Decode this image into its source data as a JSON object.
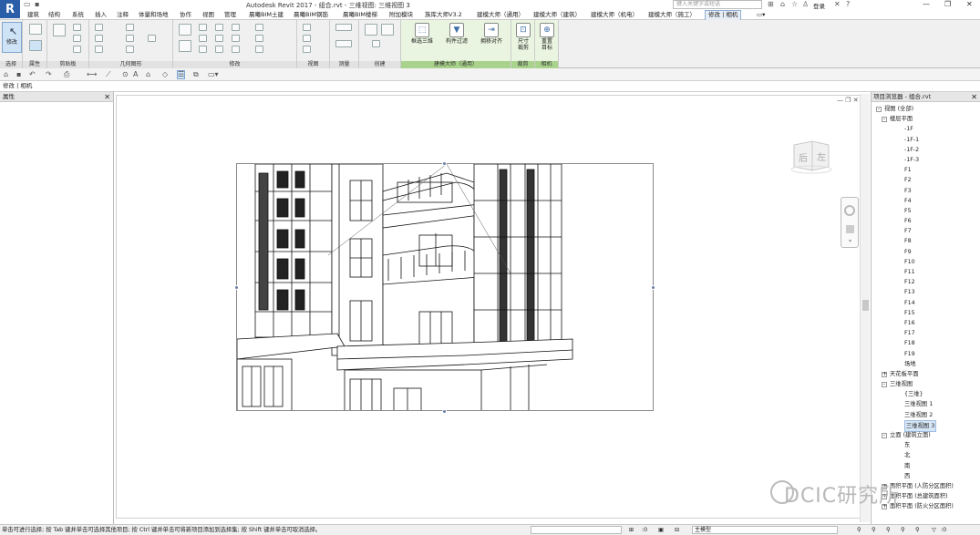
{
  "app": {
    "logo": "R",
    "title": "Autodesk Revit 2017 -    组合.rvt - 三维视图: 三维视图 3"
  },
  "search": {
    "placeholder": "键入关键字或短语"
  },
  "user": {
    "login": "登录"
  },
  "tabs": [
    "建筑",
    "结构",
    "系统",
    "插入",
    "注释",
    "体量和场地",
    "协作",
    "视图",
    "管理",
    "晨曦BIM土建",
    "晨曦BIM钢筋",
    "晨曦BIM楼梯",
    "附加模块",
    "族库大师V3.2",
    "建模大师（通用）",
    "建模大师（建筑）",
    "建模大师（机电）",
    "建模大师（施工）",
    "修改 | 相机"
  ],
  "ribbon": {
    "modify_label": "修改",
    "panels": [
      "选择",
      "属性",
      "剪贴板",
      "几何图形",
      "修改",
      "视图",
      "测量",
      "创建",
      "建模大师（通用）",
      "裁剪",
      "相机"
    ],
    "buttons": {
      "b1": "框选三维",
      "b2": "构件过滤",
      "b3": "拥移对齐",
      "b4": "尺寸\n裁剪",
      "b5": "重置\n目标"
    }
  },
  "context": {
    "label": "修改 | 相机"
  },
  "properties": {
    "title": "属性"
  },
  "browser": {
    "title": "项目浏览器 - 组合.rvt",
    "tree": [
      {
        "label": "视图 (全部)",
        "level": 0,
        "expander": "-"
      },
      {
        "label": "楼层平面",
        "level": 1,
        "expander": "-"
      },
      {
        "label": "-1F",
        "level": 2
      },
      {
        "label": "-1F-1",
        "level": 2
      },
      {
        "label": "-1F-2",
        "level": 2
      },
      {
        "label": "-1F-3",
        "level": 2
      },
      {
        "label": "F1",
        "level": 2
      },
      {
        "label": "F2",
        "level": 2
      },
      {
        "label": "F3",
        "level": 2
      },
      {
        "label": "F4",
        "level": 2
      },
      {
        "label": "F5",
        "level": 2
      },
      {
        "label": "F6",
        "level": 2
      },
      {
        "label": "F7",
        "level": 2
      },
      {
        "label": "F8",
        "level": 2
      },
      {
        "label": "F9",
        "level": 2
      },
      {
        "label": "F10",
        "level": 2
      },
      {
        "label": "F11",
        "level": 2
      },
      {
        "label": "F12",
        "level": 2
      },
      {
        "label": "F13",
        "level": 2
      },
      {
        "label": "F14",
        "level": 2
      },
      {
        "label": "F15",
        "level": 2
      },
      {
        "label": "F16",
        "level": 2
      },
      {
        "label": "F17",
        "level": 2
      },
      {
        "label": "F18",
        "level": 2
      },
      {
        "label": "F19",
        "level": 2
      },
      {
        "label": "场地",
        "level": 2
      },
      {
        "label": "天花板平面",
        "level": 1,
        "expander": "+"
      },
      {
        "label": "三维视图",
        "level": 1,
        "expander": "-"
      },
      {
        "label": "{三维}",
        "level": 2
      },
      {
        "label": "三维视图 1",
        "level": 2
      },
      {
        "label": "三维视图 2",
        "level": 2
      },
      {
        "label": "三维视图 3",
        "level": 2,
        "selected": true
      },
      {
        "label": "立面 (建筑立面)",
        "level": 1,
        "expander": "-"
      },
      {
        "label": "东",
        "level": 2
      },
      {
        "label": "北",
        "level": 2
      },
      {
        "label": "南",
        "level": 2
      },
      {
        "label": "西",
        "level": 2
      },
      {
        "label": "面积平面 (人防分区面积)",
        "level": 1,
        "expander": "+"
      },
      {
        "label": "面积平面 (总建筑面积)",
        "level": 1,
        "expander": "+"
      },
      {
        "label": "面积平面 (防火分区面积)",
        "level": 1,
        "expander": "+"
      }
    ]
  },
  "navcube": {
    "face_back": "后",
    "face_left": "左"
  },
  "status": {
    "text": "单击可进行选择; 按 Tab 键并单击可选择其他项目; 按 Ctrl 键并单击可将新项目添加到选择集; 按 Shift 键并单击可取消选择。",
    "zero": ":0",
    "model": "主模型"
  },
  "watermark": {
    "text": "DCIC研究所"
  }
}
